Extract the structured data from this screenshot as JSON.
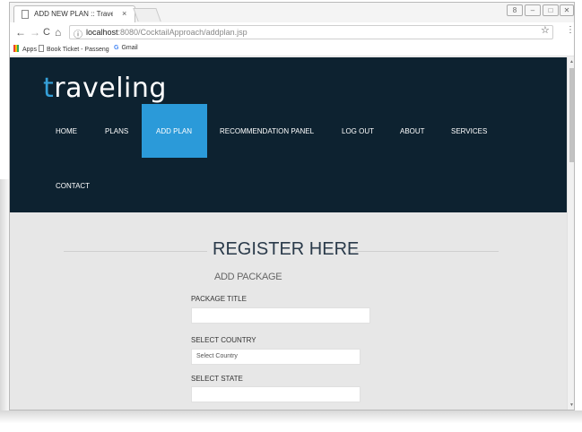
{
  "browser": {
    "tab_title": "ADD NEW PLAN :: Travel",
    "tab_close": "×",
    "window_controls": [
      "8",
      "–",
      "□",
      "✕"
    ],
    "back": "←",
    "forward": "→",
    "reload": "C",
    "home": "⌂",
    "info": "ⓘ",
    "url_host": "localhost",
    "url_rest": ":8080/CocktailApproach/addplan.jsp",
    "star": "☆",
    "menu": "⋮"
  },
  "bookmarks": {
    "apps": "Apps",
    "book_ticket": "Book Ticket - Passeng",
    "gmail": "Gmail"
  },
  "site": {
    "logo_first": "t",
    "logo_rest": "raveling",
    "nav": [
      "HOME",
      "PLANS",
      "ADD PLAN",
      "RECOMMENDATION PANEL",
      "LOG OUT",
      "ABOUT",
      "SERVICES",
      "CONTACT"
    ],
    "active_nav": "ADD PLAN"
  },
  "form": {
    "title": "REGISTER HERE",
    "subtitle": "ADD PACKAGE",
    "package_title_label": "PACKAGE TITLE",
    "package_title_value": "",
    "country_label": "SELECT COUNTRY",
    "country_placeholder": "Select Country",
    "state_label": "SELECT STATE",
    "state_value": ""
  },
  "colors": {
    "header_bg": "#0d2230",
    "nav_active": "#2b9ad9",
    "logo_accent": "#35a0d8"
  }
}
